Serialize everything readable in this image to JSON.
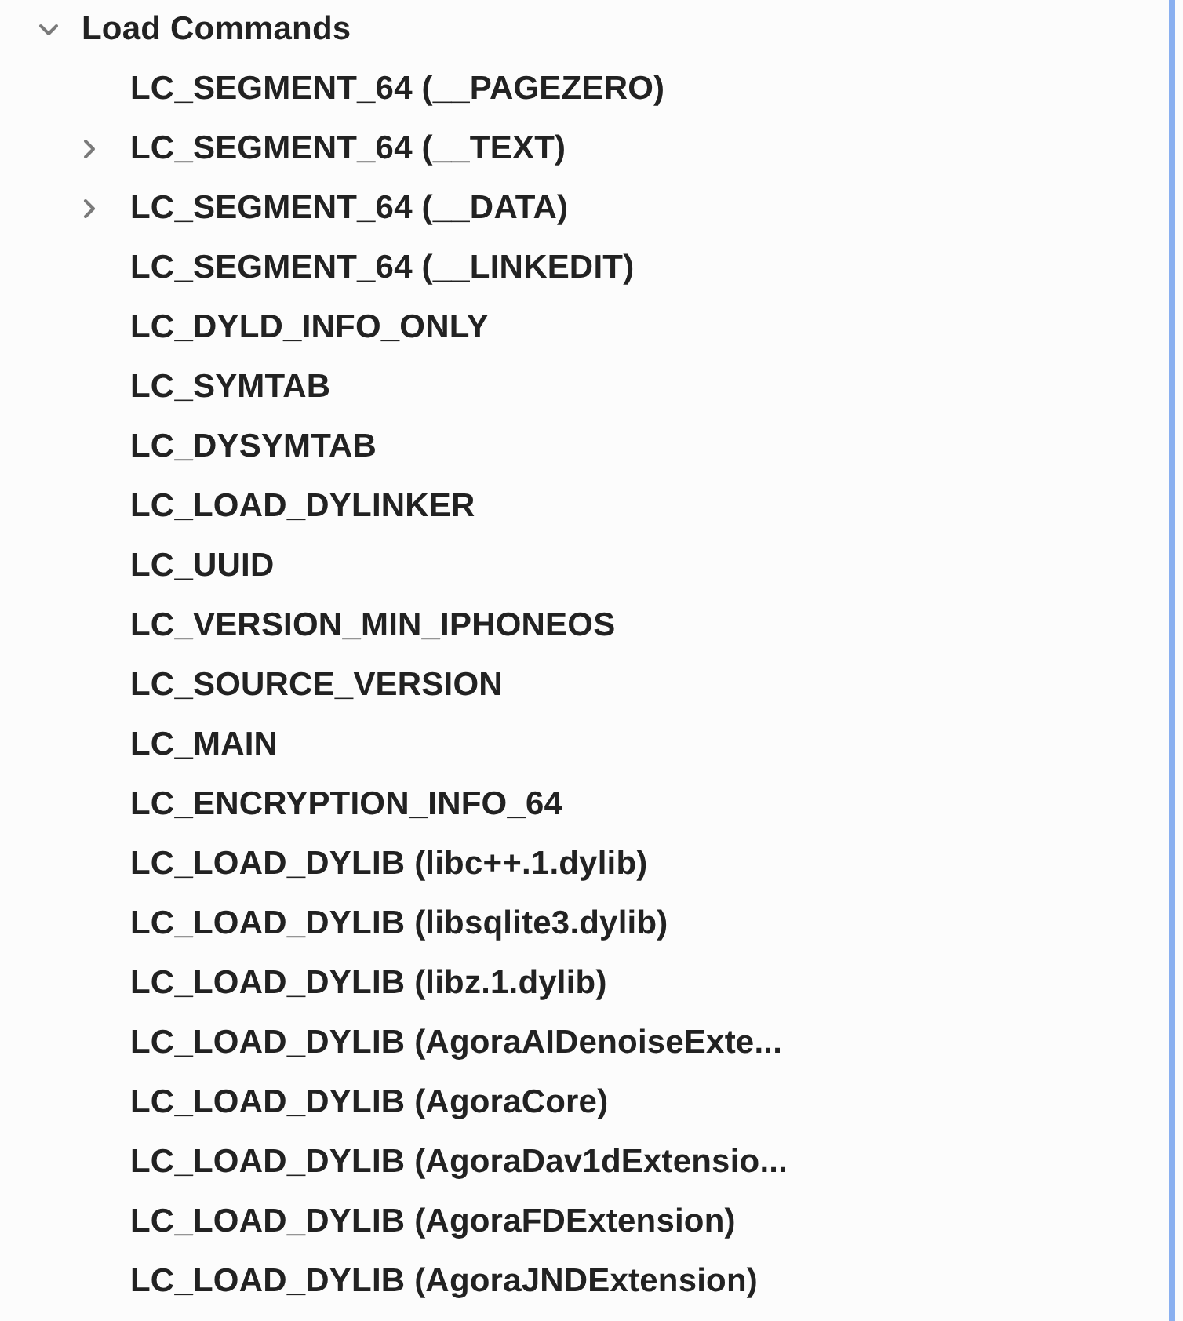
{
  "tree": {
    "label": "Load Commands",
    "expanded": true,
    "children": [
      {
        "label": "LC_SEGMENT_64 (__PAGEZERO)",
        "kind": "leaf"
      },
      {
        "label": "LC_SEGMENT_64 (__TEXT)",
        "kind": "group",
        "expanded": false
      },
      {
        "label": "LC_SEGMENT_64 (__DATA)",
        "kind": "group",
        "expanded": false
      },
      {
        "label": "LC_SEGMENT_64 (__LINKEDIT)",
        "kind": "leaf"
      },
      {
        "label": "LC_DYLD_INFO_ONLY",
        "kind": "leaf"
      },
      {
        "label": "LC_SYMTAB",
        "kind": "leaf"
      },
      {
        "label": "LC_DYSYMTAB",
        "kind": "leaf"
      },
      {
        "label": "LC_LOAD_DYLINKER",
        "kind": "leaf"
      },
      {
        "label": "LC_UUID",
        "kind": "leaf"
      },
      {
        "label": "LC_VERSION_MIN_IPHONEOS",
        "kind": "leaf"
      },
      {
        "label": "LC_SOURCE_VERSION",
        "kind": "leaf"
      },
      {
        "label": "LC_MAIN",
        "kind": "leaf"
      },
      {
        "label": "LC_ENCRYPTION_INFO_64",
        "kind": "leaf"
      },
      {
        "label": "LC_LOAD_DYLIB (libc++.1.dylib)",
        "kind": "leaf"
      },
      {
        "label": "LC_LOAD_DYLIB (libsqlite3.dylib)",
        "kind": "leaf"
      },
      {
        "label": "LC_LOAD_DYLIB (libz.1.dylib)",
        "kind": "leaf"
      },
      {
        "label": "LC_LOAD_DYLIB (AgoraAIDenoiseExte...",
        "kind": "leaf"
      },
      {
        "label": "LC_LOAD_DYLIB (AgoraCore)",
        "kind": "leaf"
      },
      {
        "label": "LC_LOAD_DYLIB (AgoraDav1dExtensio...",
        "kind": "leaf"
      },
      {
        "label": "LC_LOAD_DYLIB (AgoraFDExtension)",
        "kind": "leaf"
      },
      {
        "label": "LC_LOAD_DYLIB (AgoraJNDExtension)",
        "kind": "leaf"
      }
    ]
  }
}
